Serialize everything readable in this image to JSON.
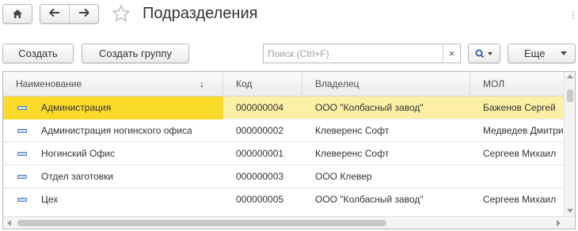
{
  "window": {
    "title": "Подразделения",
    "more_dots": "⋮"
  },
  "toolbar": {
    "create_label": "Создать",
    "create_group_label": "Создать группу",
    "search_placeholder": "Поиск (Ctrl+F)",
    "search_value": "",
    "clear_symbol": "×",
    "more_label": "Еще"
  },
  "icons": {
    "home": "home-icon",
    "back": "arrow-left-icon",
    "forward": "arrow-right-icon",
    "favorite": "star-icon",
    "search": "magnifier-icon",
    "sort": "sort-down-arrow-icon",
    "row": "department-item-icon"
  },
  "colors": {
    "selected_row": "#fbf0a6",
    "selected_cell": "#fadb2a",
    "row_icon": "#4a7ebb"
  },
  "table": {
    "columns": [
      {
        "key": "name",
        "label": "Наименование"
      },
      {
        "key": "code",
        "label": "Код"
      },
      {
        "key": "owner",
        "label": "Владелец"
      },
      {
        "key": "mol",
        "label": "МОЛ"
      }
    ],
    "sort_symbol": "↓",
    "rows": [
      {
        "name": "Администрация",
        "code": "000000004",
        "owner": "ООО \"Колбасный завод\"",
        "mol": "Баженов Сергей",
        "selected": true
      },
      {
        "name": "Администрация ногинского офиса",
        "code": "000000002",
        "owner": "Клеверенс Софт",
        "mol": "Медведев Дмитрий",
        "selected": false
      },
      {
        "name": "Ногинский Офис",
        "code": "000000001",
        "owner": "Клеверенс Софт",
        "mol": "Сергеев Михаил",
        "selected": false
      },
      {
        "name": "Отдел заготовки",
        "code": "000000003",
        "owner": "ООО Клевер",
        "mol": "",
        "selected": false
      },
      {
        "name": "Цех",
        "code": "000000005",
        "owner": "ООО \"Колбасный завод\"",
        "mol": "Сергеев Михаил",
        "selected": false
      }
    ]
  }
}
